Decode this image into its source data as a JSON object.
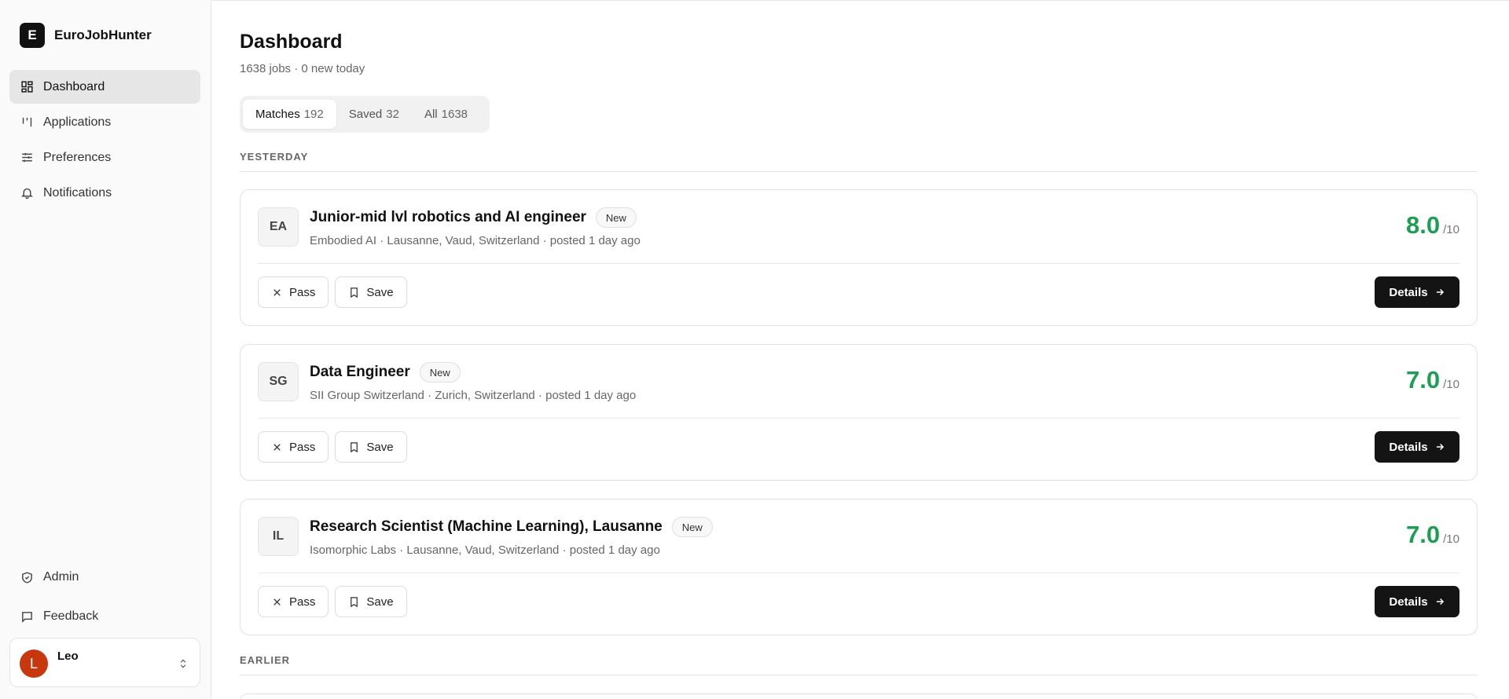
{
  "brand": {
    "logo_letter": "E",
    "name": "EuroJobHunter"
  },
  "sidebar": {
    "items": [
      {
        "label": "Dashboard",
        "icon": "dashboard-icon",
        "active": true
      },
      {
        "label": "Applications",
        "icon": "kanban-icon"
      },
      {
        "label": "Preferences",
        "icon": "sliders-icon"
      },
      {
        "label": "Notifications",
        "icon": "bell-icon"
      }
    ],
    "bottom_items": [
      {
        "label": "Admin",
        "icon": "shield-icon"
      },
      {
        "label": "Feedback",
        "icon": "message-icon"
      }
    ],
    "user": {
      "initial": "L",
      "name": "Leo"
    }
  },
  "header": {
    "title": "Dashboard",
    "subtitle": "1638 jobs · 0 new today"
  },
  "tabs": [
    {
      "label": "Matches",
      "count": "192",
      "active": true
    },
    {
      "label": "Saved",
      "count": "32"
    },
    {
      "label": "All",
      "count": "1638"
    }
  ],
  "sections": {
    "yesterday": "YESTERDAY",
    "earlier": "EARLIER"
  },
  "jobs": [
    {
      "initials": "EA",
      "title": "Junior-mid lvl robotics and AI engineer",
      "badge": "New",
      "meta": "Embodied AI · Lausanne, Vaud, Switzerland · posted 1 day ago",
      "score": "8.0",
      "score_max": "/10"
    },
    {
      "initials": "SG",
      "title": "Data Engineer",
      "badge": "New",
      "meta": "SII Group Switzerland · Zurich, Switzerland · posted 1 day ago",
      "score": "7.0",
      "score_max": "/10"
    },
    {
      "initials": "IL",
      "title": "Research Scientist (Machine Learning), Lausanne",
      "badge": "New",
      "meta": "Isomorphic Labs · Lausanne, Vaud, Switzerland · posted 1 day ago",
      "score": "7.0",
      "score_max": "/10"
    }
  ],
  "actions": {
    "pass": "Pass",
    "save": "Save",
    "details": "Details"
  },
  "colors": {
    "score_green": "#1f9d55",
    "dark_button": "#141414",
    "avatar": "#c7380f"
  }
}
